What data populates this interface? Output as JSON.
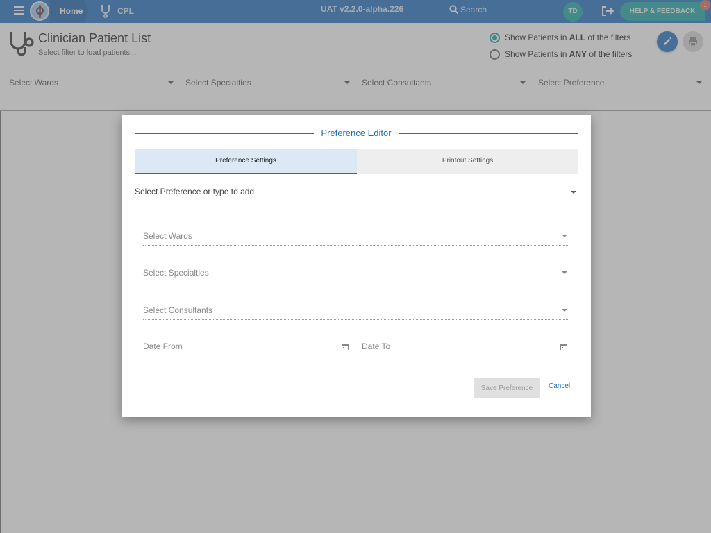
{
  "topbar": {
    "home_label": "Home",
    "app_label": "CPL",
    "version": "UAT v2.2.0-alpha.226",
    "search_placeholder": "Search",
    "user_initials": "TD",
    "help_label": "HELP & FEEDBACK",
    "help_badge_count": "1",
    "color": "#1e6fbf"
  },
  "header": {
    "title": "Clinician Patient List",
    "subtitle": "Select filter to load patients...",
    "radio_all": {
      "prefix": "Show Patients in ",
      "bold": "ALL",
      "suffix": " of the filters",
      "checked": true
    },
    "radio_any": {
      "prefix": "Show Patients in ",
      "bold": "ANY",
      "suffix": " of the filters",
      "checked": false
    }
  },
  "filters": [
    "Select Wards",
    "Select Specialties",
    "Select Consultants",
    "Select Preference"
  ],
  "dialog": {
    "title": "Preference Editor",
    "tabs": [
      {
        "label": "Preference Settings",
        "active": true
      },
      {
        "label": "Printout Settings",
        "active": false
      }
    ],
    "preference_placeholder": "Select Preference or type to add",
    "selects": [
      "Select Wards",
      "Select Specialties",
      "Select Consultants"
    ],
    "date_from": "Date From",
    "date_to": "Date To",
    "save_label": "Save Preference",
    "cancel_label": "Cancel"
  }
}
